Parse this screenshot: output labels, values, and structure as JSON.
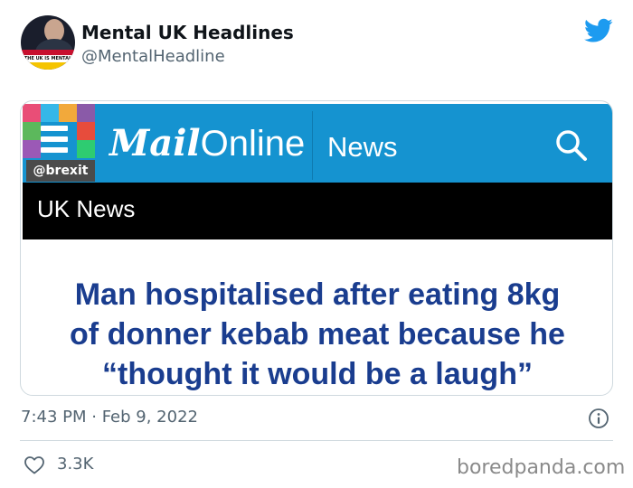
{
  "author": {
    "name": "Mental UK Headlines",
    "handle": "@MentalHeadline",
    "avatar_text": "THE UK IS MENTAL"
  },
  "icons": {
    "platform": "twitter-bird-icon",
    "info": "info-icon",
    "like": "heart-icon",
    "search": "search-icon"
  },
  "colors": {
    "twitter_blue": "#1d9bf0",
    "mailonline_blue": "#1593d0",
    "headline_blue": "#1a3d8f",
    "muted_text": "#536471"
  },
  "embedded_article": {
    "tag": "@brexit",
    "logo_bold": "Mail",
    "logo_light": "Online",
    "section": "News",
    "subsection": "UK News",
    "headline_lines": [
      "Man hospitalised after eating 8kg",
      "of donner kebab meat because he",
      "“thought it would be a laugh”"
    ]
  },
  "tweet": {
    "timestamp": "7:43 PM · Feb 9, 2022",
    "likes": "3.3K"
  },
  "watermark": "boredpanda.com"
}
